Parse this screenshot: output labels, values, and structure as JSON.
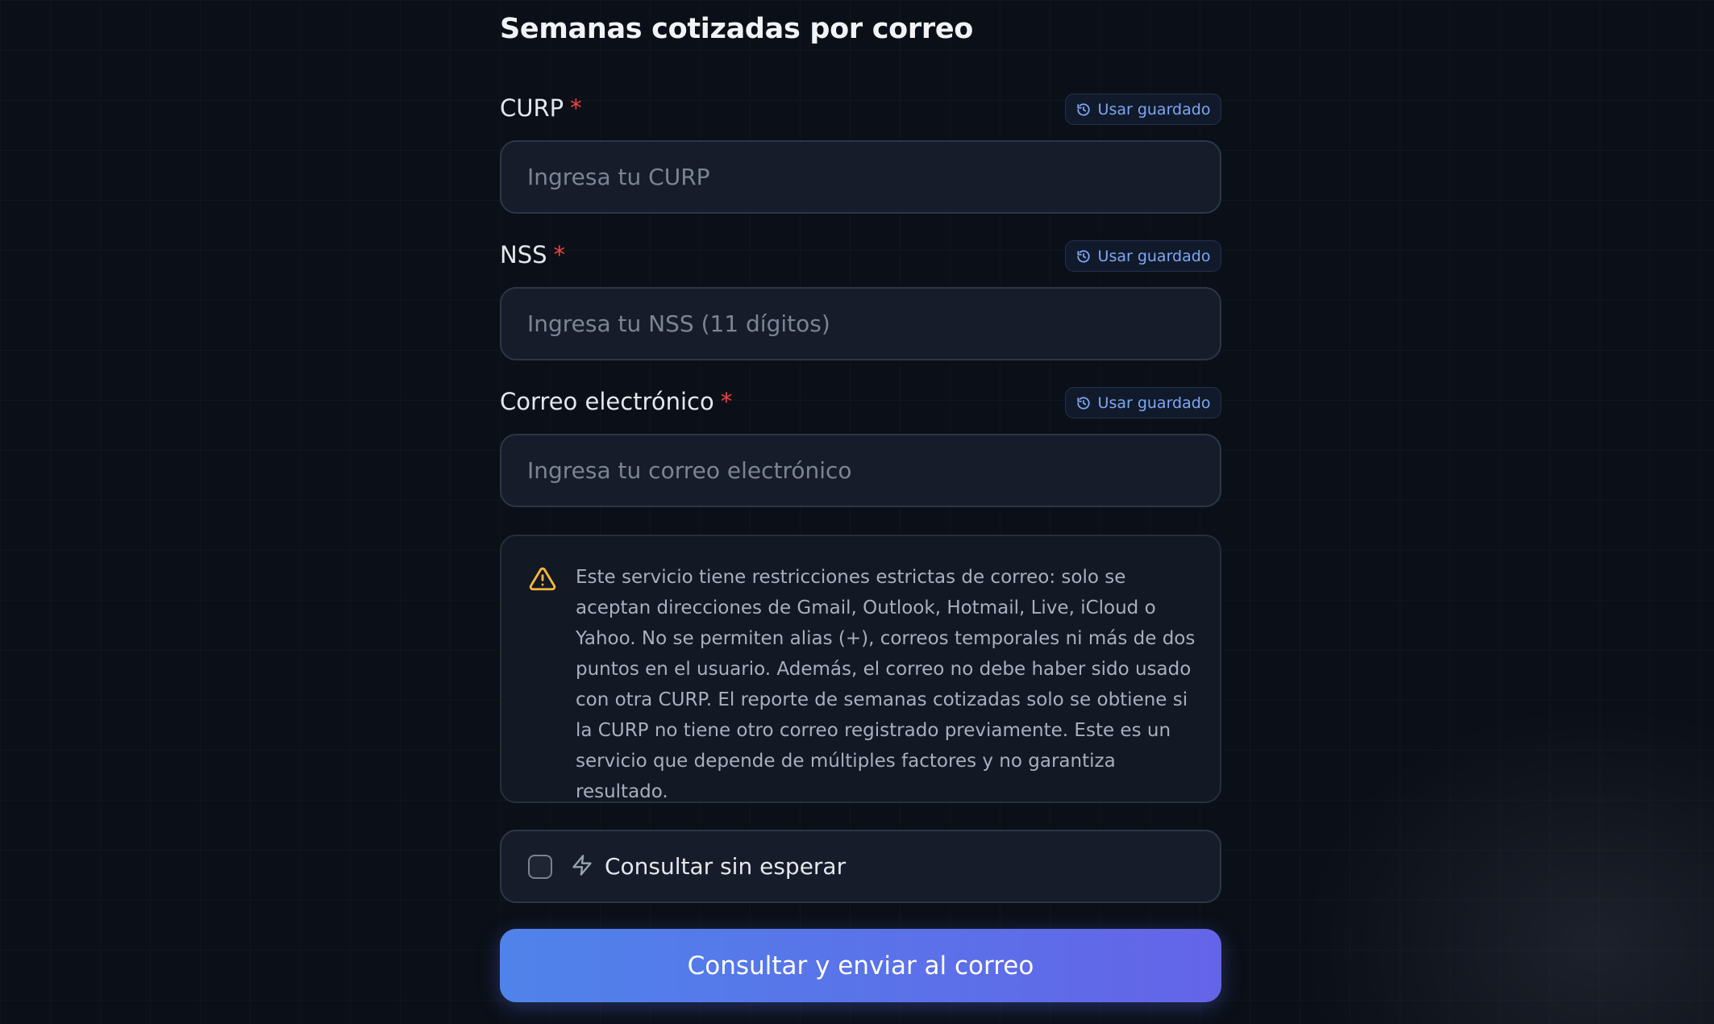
{
  "page": {
    "title": "Semanas cotizadas por correo"
  },
  "fields": [
    {
      "label": "CURP",
      "required_mark": "*",
      "saved_button": "Usar guardado",
      "placeholder": "Ingresa tu CURP",
      "value": ""
    },
    {
      "label": "NSS",
      "required_mark": "*",
      "saved_button": "Usar guardado",
      "placeholder": "Ingresa tu NSS (11 dígitos)",
      "value": ""
    },
    {
      "label": "Correo electrónico",
      "required_mark": "*",
      "saved_button": "Usar guardado",
      "placeholder": "Ingresa tu correo electrónico",
      "value": ""
    }
  ],
  "notice": {
    "icon": "warning-icon",
    "text": "Este servicio tiene restricciones estrictas de correo: solo se aceptan direcciones de Gmail, Outlook, Hotmail, Live, iCloud o Yahoo. No se permiten alias (+), correos temporales ni más de dos puntos en el usuario. Además, el correo no debe haber sido usado con otra CURP. El reporte de semanas cotizadas solo se obtiene si la CURP no tiene otro correo registrado previamente. Este es un servicio que depende de múltiples factores y no garantiza resultado."
  },
  "options": {
    "no_wait_label": "Consultar sin esperar",
    "no_wait_checked": false,
    "icon": "bolt-icon"
  },
  "submit": {
    "label": "Consultar y enviar al correo"
  },
  "colors": {
    "background": "#0b0f17",
    "accent": "#7ea7f3",
    "required": "#ef4444",
    "warning": "#f5b83a",
    "button_gradient_start": "#4f83ea",
    "button_gradient_end": "#6464e8"
  }
}
